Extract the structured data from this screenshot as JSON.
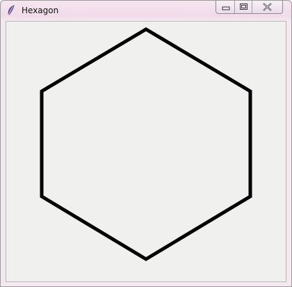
{
  "window": {
    "title": "Hexagon",
    "icon": "feather-icon"
  },
  "caption_buttons": {
    "minimize_icon": "minimize-icon",
    "maximize_icon": "maximize-icon",
    "close_icon": "close-icon"
  },
  "canvas": {
    "background": "#f0f0ef",
    "shape": "hexagon",
    "stroke_color": "#000000"
  }
}
